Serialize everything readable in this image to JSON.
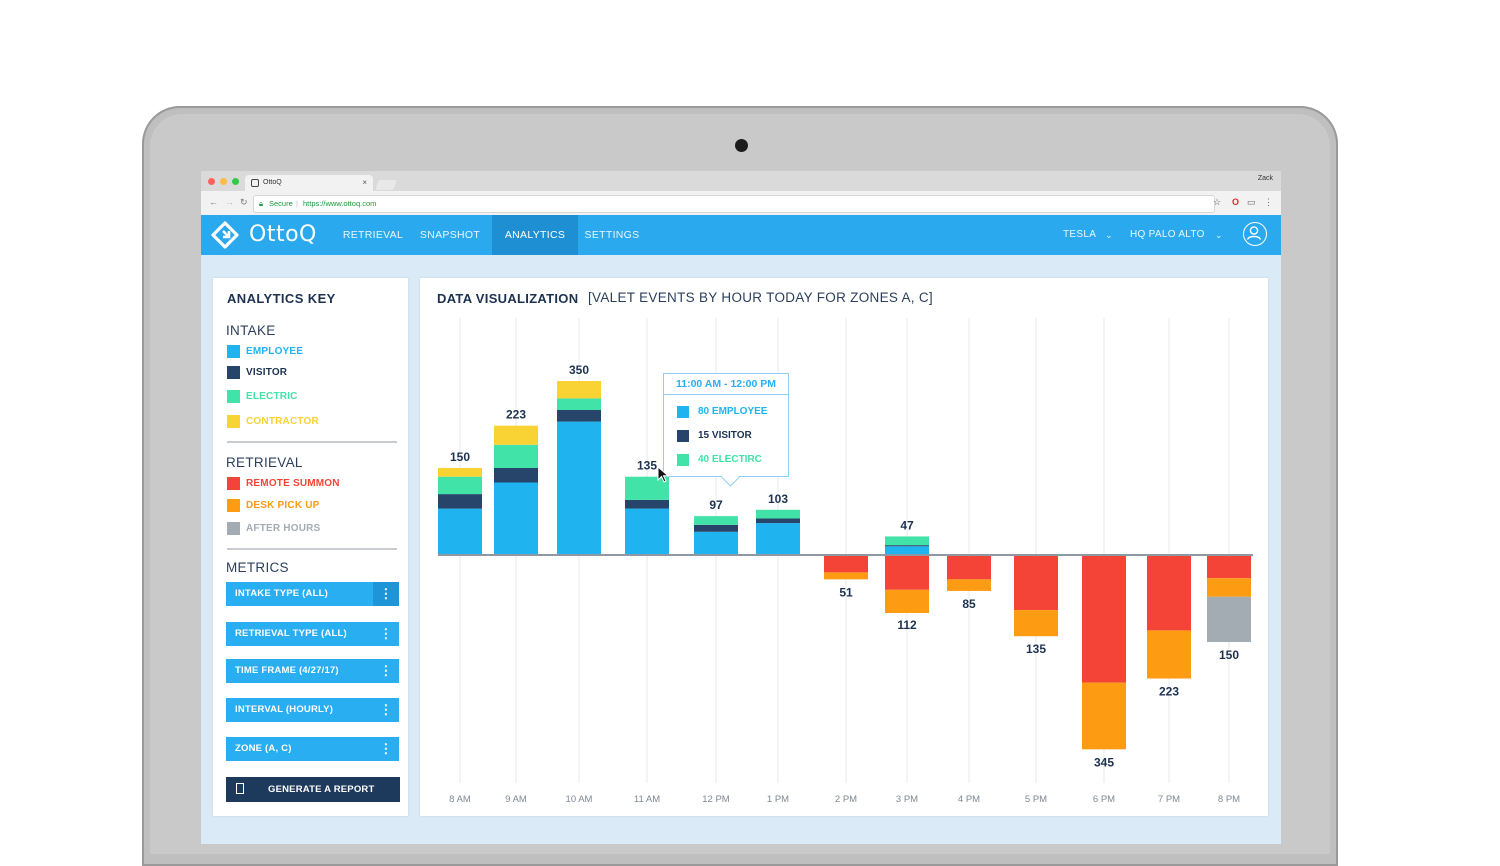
{
  "browser": {
    "tab_title": "OttoQ",
    "tab_close": "×",
    "user_name": "Zack",
    "secure_label": "Secure",
    "url": "https://www.ottoq.com"
  },
  "app": {
    "logo_text": "OttoQ",
    "nav": [
      {
        "label": "RETRIEVAL"
      },
      {
        "label": "SNAPSHOT"
      },
      {
        "label": "ANALYTICS",
        "active": true
      },
      {
        "label": "SETTINGS"
      }
    ],
    "company_select": "TESLA",
    "location_select": "HQ PALO ALTO"
  },
  "key": {
    "title": "ANALYTICS KEY",
    "intake_title": "INTAKE",
    "intake_items": [
      {
        "label": "EMPLOYEE",
        "color": "#1fb3f0"
      },
      {
        "label": "VISITOR",
        "color": "#27456b"
      },
      {
        "label": "ELECTRIC",
        "color": "#41e3a8"
      },
      {
        "label": "CONTRACTOR",
        "color": "#f9d233"
      }
    ],
    "retrieval_title": "RETRIEVAL",
    "retrieval_items": [
      {
        "label": "REMOTE SUMMON",
        "color": "#f34437"
      },
      {
        "label": "DESK PICK UP",
        "color": "#fd9b13"
      },
      {
        "label": "AFTER HOURS",
        "color": "#a3abb3"
      }
    ],
    "metrics_title": "METRICS",
    "metrics": [
      {
        "label": "INTAKE TYPE (ALL)"
      },
      {
        "label": "RETRIEVAL TYPE (ALL)"
      },
      {
        "label": "TIME FRAME (4/27/17)"
      },
      {
        "label": "INTERVAL (HOURLY)"
      },
      {
        "label": "ZONE (A, C)"
      }
    ],
    "report_button": "GENERATE A REPORT",
    "more_glyph": "⋮"
  },
  "chart": {
    "title": "DATA VISUALIZATION",
    "subtitle": "[VALET EVENTS BY HOUR TODAY FOR ZONES A, C]",
    "tooltip": {
      "title": "11:00 AM - 12:00 PM",
      "rows": [
        {
          "label": "80 EMPLOYEE",
          "color": "#1fb3f0"
        },
        {
          "label": "15 VISITOR",
          "color": "#27456b"
        },
        {
          "label": "40 ELECTIRC",
          "color": "#41e3a8"
        }
      ]
    }
  },
  "chart_data": {
    "type": "bar",
    "stacked": true,
    "diverging": true,
    "categories": [
      "8 AM",
      "9 AM",
      "10 AM",
      "11 AM",
      "12 PM",
      "1 PM",
      "2 PM",
      "3 PM",
      "4 PM",
      "5 PM",
      "6 PM",
      "7 PM",
      "8 PM"
    ],
    "totals": [
      150,
      223,
      350,
      135,
      97,
      103,
      51,
      47,
      85,
      135,
      345,
      223,
      150
    ],
    "below_totals": [
      null,
      null,
      null,
      null,
      null,
      null,
      null,
      112,
      null,
      null,
      null,
      null,
      null
    ],
    "intake_series": [
      {
        "name": "EMPLOYEE",
        "color": "#1fb3f0",
        "values": [
          80,
          125,
          230,
          80,
          40,
          55,
          0,
          15,
          0,
          0,
          0,
          0,
          0
        ]
      },
      {
        "name": "VISITOR",
        "color": "#27456b",
        "values": [
          25,
          25,
          20,
          15,
          12,
          8,
          0,
          2,
          0,
          0,
          0,
          0,
          0
        ]
      },
      {
        "name": "ELECTRIC",
        "color": "#41e3a8",
        "values": [
          30,
          40,
          20,
          40,
          15,
          15,
          0,
          15,
          0,
          0,
          0,
          0,
          0
        ]
      },
      {
        "name": "CONTRACTOR",
        "color": "#f9d233",
        "values": [
          15,
          33,
          30,
          0,
          0,
          0,
          0,
          0,
          0,
          0,
          0,
          0,
          0
        ]
      }
    ],
    "retrieval_series": [
      {
        "name": "REMOTE SUMMON",
        "color": "#f34437",
        "values": [
          0,
          0,
          0,
          0,
          0,
          0,
          30,
          60,
          42,
          95,
          220,
          130,
          40
        ]
      },
      {
        "name": "DESK PICK UP",
        "color": "#fd9b13",
        "values": [
          0,
          0,
          0,
          0,
          0,
          0,
          12,
          40,
          20,
          45,
          115,
          83,
          32
        ]
      },
      {
        "name": "AFTER HOURS",
        "color": "#a3abb3",
        "values": [
          0,
          0,
          0,
          0,
          0,
          0,
          0,
          0,
          0,
          0,
          0,
          0,
          78
        ]
      }
    ]
  }
}
